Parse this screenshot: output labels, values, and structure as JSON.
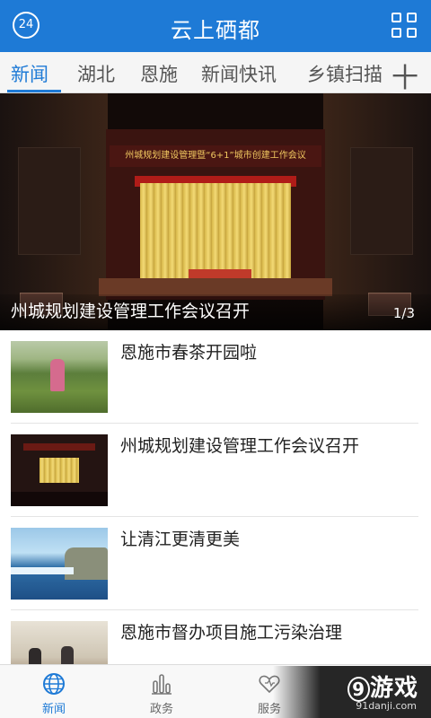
{
  "header": {
    "title": "云上硒都",
    "badge_text": "24",
    "left_icon": "24-hour-news-icon",
    "right_icon": "grid-menu-icon"
  },
  "tabs": [
    {
      "label": "新闻",
      "active": true
    },
    {
      "label": "湖北",
      "active": false
    },
    {
      "label": "恩施",
      "active": false
    },
    {
      "label": "新闻快讯",
      "active": false
    },
    {
      "label": "乡镇扫描",
      "active": false
    }
  ],
  "tabs_more_label": "十",
  "hero": {
    "caption": "州城规划建设管理工作会议召开",
    "pager": "1/3",
    "banner_text": "州城规划建设管理暨“6+1”城市创建工作会议"
  },
  "news": [
    {
      "title": "恩施市春茶开园啦",
      "thumb": "tea-garden"
    },
    {
      "title": "州城规划建设管理工作会议召开",
      "thumb": "conference-hall"
    },
    {
      "title": "让清江更清更美",
      "thumb": "river"
    },
    {
      "title": "恩施市督办项目施工污染治理",
      "thumb": "meeting-room"
    }
  ],
  "bottom_nav": [
    {
      "label": "新闻",
      "icon": "globe-icon",
      "active": true
    },
    {
      "label": "政务",
      "icon": "bar-chart-icon",
      "active": false
    },
    {
      "label": "服务",
      "icon": "heart-icon",
      "active": false
    }
  ],
  "watermark": {
    "logo_number": "9",
    "logo_text": "游戏",
    "url": "91danji.com"
  },
  "colors": {
    "primary": "#1e7ad6",
    "tab_bg": "#f5f5f5",
    "text": "#222222"
  }
}
